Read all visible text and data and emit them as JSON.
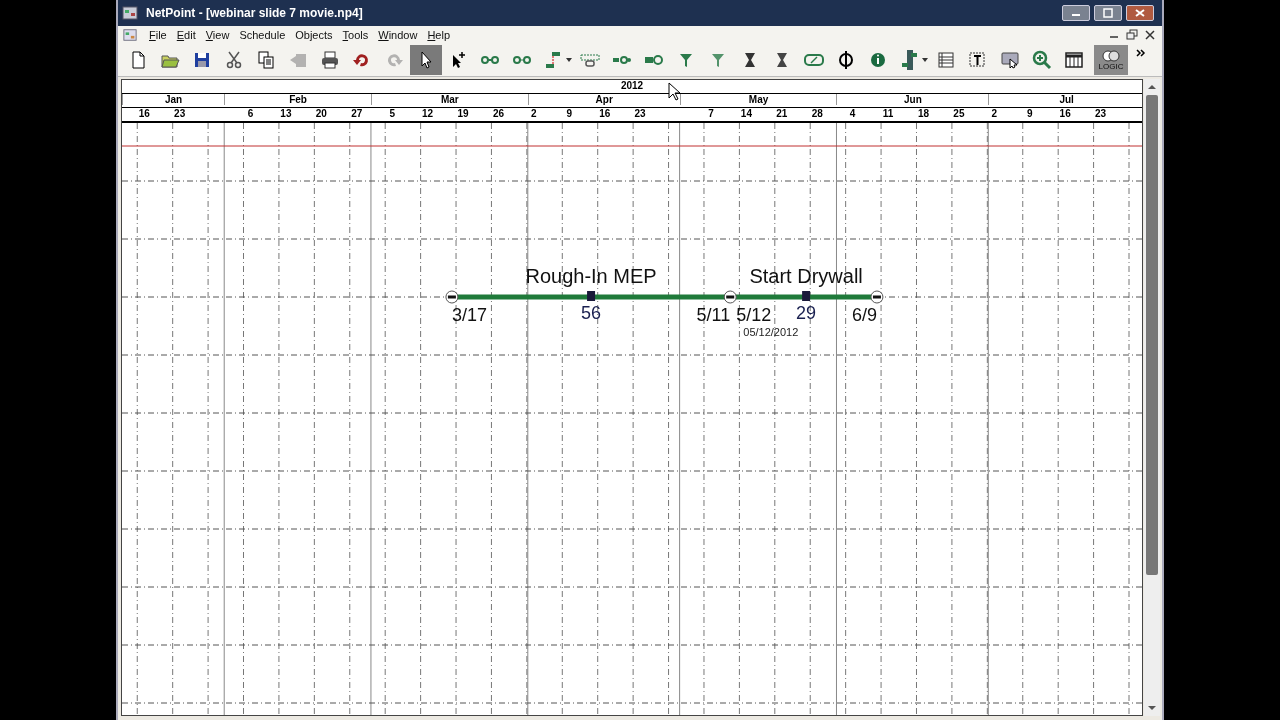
{
  "window": {
    "title": "NetPoint - [webinar slide 7 movie.np4]"
  },
  "menu": [
    {
      "label": "File",
      "mnemonic": true
    },
    {
      "label": "Edit",
      "mnemonic": true
    },
    {
      "label": "View",
      "mnemonic": true
    },
    {
      "label": "Schedule",
      "mnemonic": false
    },
    {
      "label": "Objects",
      "mnemonic": false
    },
    {
      "label": "Tools",
      "mnemonic": true
    },
    {
      "label": "Window",
      "mnemonic": true
    },
    {
      "label": "Help",
      "mnemonic": true
    }
  ],
  "toolbar": {
    "buttons": [
      {
        "selected": false,
        "disabled": false
      },
      {
        "selected": false,
        "disabled": false
      },
      {
        "selected": false,
        "disabled": false
      },
      {
        "selected": false,
        "disabled": false
      },
      {
        "selected": false,
        "disabled": false
      },
      {
        "selected": false,
        "disabled": true
      },
      {
        "selected": false,
        "disabled": false
      },
      {
        "selected": false,
        "disabled": false
      },
      {
        "selected": false,
        "disabled": true
      },
      {
        "selected": true,
        "disabled": false
      },
      {
        "selected": false,
        "disabled": false
      },
      {
        "selected": false,
        "disabled": false
      },
      {
        "selected": false,
        "disabled": false
      },
      {
        "selected": false,
        "disabled": false
      },
      {
        "selected": false,
        "disabled": false
      },
      {
        "selected": false,
        "disabled": false
      },
      {
        "selected": false,
        "disabled": false
      },
      {
        "selected": false,
        "disabled": false
      },
      {
        "selected": false,
        "disabled": false
      },
      {
        "selected": false,
        "disabled": false
      },
      {
        "selected": false,
        "disabled": false
      },
      {
        "selected": false,
        "disabled": false
      },
      {
        "selected": false,
        "disabled": false
      },
      {
        "selected": false,
        "disabled": false
      },
      {
        "selected": false,
        "disabled": false
      },
      {
        "selected": false,
        "disabled": false
      },
      {
        "selected": false,
        "disabled": false
      },
      {
        "selected": false,
        "disabled": false
      },
      {
        "selected": false,
        "disabled": false
      },
      {
        "selected": false,
        "disabled": false
      }
    ],
    "logic_button": {
      "label": "LOGIC",
      "selected": true
    }
  },
  "timeline": {
    "year": "2012",
    "months": [
      {
        "label": "Jan",
        "weeks": [
          "16",
          "23"
        ]
      },
      {
        "label": "Feb",
        "weeks": [
          "6",
          "13",
          "20",
          "27"
        ]
      },
      {
        "label": "Mar",
        "weeks": [
          "5",
          "12",
          "19",
          "26"
        ]
      },
      {
        "label": "Apr",
        "weeks": [
          "2",
          "9",
          "16",
          "23"
        ]
      },
      {
        "label": "May",
        "weeks": [
          "7",
          "14",
          "21",
          "28"
        ]
      },
      {
        "label": "Jun",
        "weeks": [
          "4",
          "11",
          "18",
          "25"
        ]
      },
      {
        "label": "Jul",
        "weeks": [
          "2",
          "9",
          "16",
          "23"
        ]
      }
    ]
  },
  "activities": [
    {
      "name": "Rough-In MEP",
      "start": "3/17",
      "duration": "56",
      "finish": "5/11"
    },
    {
      "name": "Start Drywall",
      "start": "5/12",
      "start_date": "05/12/2012",
      "duration": "29",
      "finish": "6/9"
    }
  ]
}
